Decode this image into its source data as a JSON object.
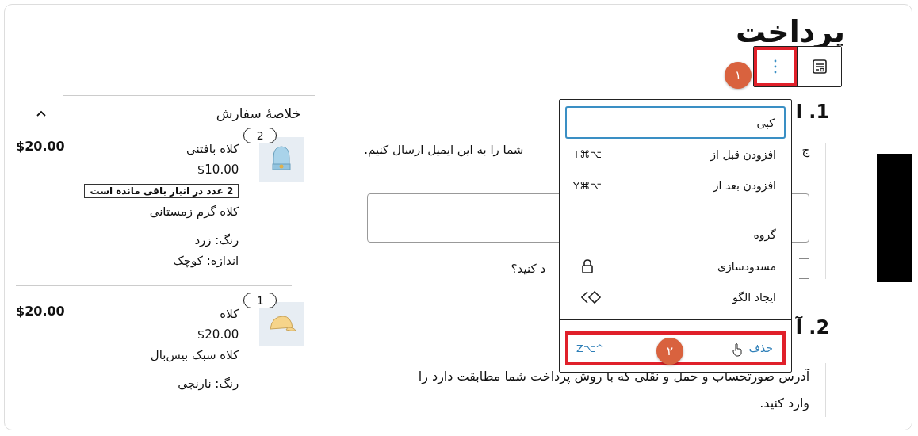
{
  "page_title": "پرداخت",
  "block_toolbar": [
    {
      "kind": "block",
      "highlighted": false
    },
    {
      "kind": "more",
      "highlighted": true
    }
  ],
  "annotations": [
    {
      "label": "١"
    },
    {
      "label": "٢"
    }
  ],
  "block_menu": [
    [
      {
        "label": "کپی",
        "focused": true,
        "highlighted": false,
        "kind": "plain"
      },
      {
        "label": "افزودن قبل از",
        "shortcut": "T⌘⌥",
        "focused": false,
        "highlighted": false,
        "kind": "plain"
      },
      {
        "label": "افزودن بعد از",
        "shortcut": "Y⌘⌥",
        "focused": false,
        "highlighted": false,
        "kind": "plain"
      }
    ],
    [
      {
        "label": "گروه",
        "focused": false,
        "highlighted": false,
        "kind": "plain"
      },
      {
        "label": "مسدودسازی",
        "focused": false,
        "highlighted": false,
        "kind": "lock"
      },
      {
        "label": "ایجاد الگو",
        "focused": false,
        "highlighted": false,
        "kind": "pattern"
      }
    ],
    [
      {
        "label": "حذف",
        "shortcut": "Z⌥^",
        "focused": false,
        "highlighted": true,
        "kind": "danger"
      }
    ]
  ],
  "contact": {
    "heading": "1. ا",
    "text_right": "ج",
    "text_left": "شما را به این ایمیل ارسال کنیم.",
    "checkbox_label": "د کنید؟",
    "checked": false
  },
  "address": {
    "heading": "2. آ",
    "text": "آدرس صورتحساب و حمل و نقلی که با روش پرداخت شما مطابقت دارد را وارد کنید."
  },
  "order_summary": {
    "title": "خلاصهٔ سفارش",
    "expanded": true,
    "items": [
      {
        "kind": "beanie",
        "quantity": "2",
        "name": "کلاه بافتنی",
        "price": "$10.00",
        "stock_note": "2 عدد در انبار باقی مانده است",
        "description": "کلاه گرم زمستانی",
        "attributes": [
          "رنگ: زرد",
          "اندازه: کوچک"
        ],
        "total": "$20.00"
      },
      {
        "kind": "cap",
        "quantity": "1",
        "name": "کلاه",
        "price": "$20.00",
        "description": "کلاه سبک بیس‌بال",
        "attributes": [
          "رنگ: نارنجی"
        ],
        "total": "$20.00"
      }
    ]
  }
}
